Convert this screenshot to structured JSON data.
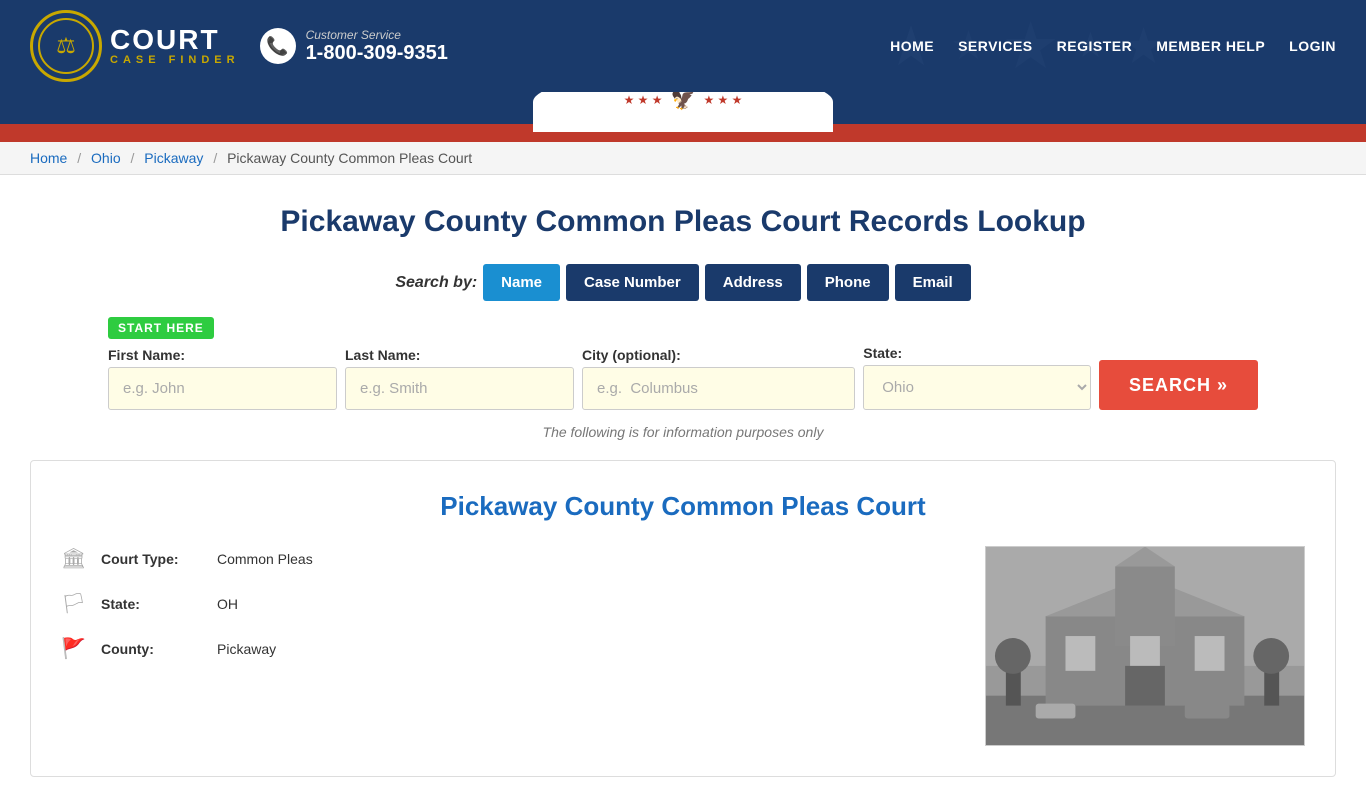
{
  "header": {
    "logo": {
      "court": "COURT",
      "case_finder": "CASE FINDER",
      "icon": "⚖"
    },
    "phone": {
      "customer_service": "Customer Service",
      "number": "1-800-309-9351"
    },
    "nav": [
      {
        "label": "HOME",
        "href": "#"
      },
      {
        "label": "SERVICES",
        "href": "#"
      },
      {
        "label": "REGISTER",
        "href": "#"
      },
      {
        "label": "MEMBER HELP",
        "href": "#"
      },
      {
        "label": "LOGIN",
        "href": "#"
      }
    ]
  },
  "breadcrumb": {
    "items": [
      {
        "label": "Home",
        "href": "#"
      },
      {
        "label": "Ohio",
        "href": "#"
      },
      {
        "label": "Pickaway",
        "href": "#"
      },
      {
        "label": "Pickaway County Common Pleas Court",
        "href": null
      }
    ]
  },
  "page": {
    "title": "Pickaway County Common Pleas Court Records Lookup",
    "search_by_label": "Search by:",
    "tabs": [
      {
        "label": "Name",
        "active": true
      },
      {
        "label": "Case Number",
        "active": false
      },
      {
        "label": "Address",
        "active": false
      },
      {
        "label": "Phone",
        "active": false
      },
      {
        "label": "Email",
        "active": false
      }
    ],
    "start_here": "START HERE",
    "form": {
      "first_name_label": "First Name:",
      "first_name_placeholder": "e.g. John",
      "last_name_label": "Last Name:",
      "last_name_placeholder": "e.g. Smith",
      "city_label": "City (optional):",
      "city_placeholder": "e.g.  Columbus",
      "state_label": "State:",
      "state_value": "Ohio",
      "state_options": [
        "Ohio"
      ],
      "search_btn": "SEARCH »"
    },
    "info_note": "The following is for information purposes only"
  },
  "court_card": {
    "title": "Pickaway County Common Pleas Court",
    "details": [
      {
        "icon": "🏛",
        "label": "Court Type:",
        "value": "Common Pleas"
      },
      {
        "icon": "🏳",
        "label": "State:",
        "value": "OH"
      },
      {
        "icon": "🚩",
        "label": "County:",
        "value": "Pickaway"
      }
    ]
  },
  "colors": {
    "primary_blue": "#1a3a6b",
    "light_blue": "#1a6bbf",
    "red": "#c0392b",
    "green": "#2ecc40",
    "search_red": "#e74c3c",
    "tab_active": "#1a8fd1",
    "input_bg": "#fffde6"
  }
}
